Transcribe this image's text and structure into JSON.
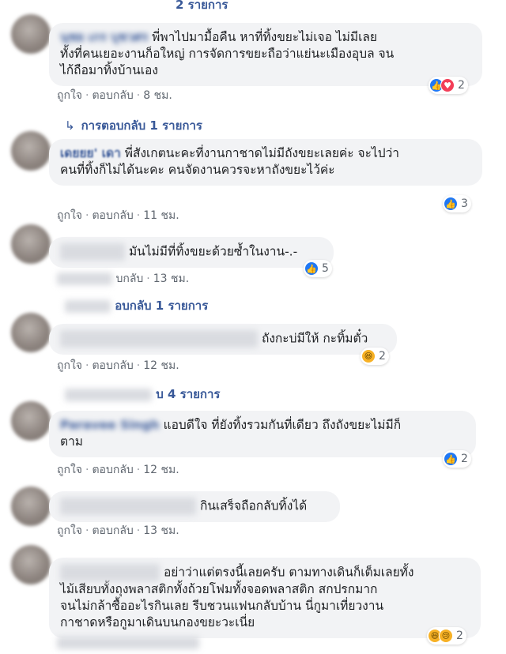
{
  "top_partial": {
    "text": "2 รายการ"
  },
  "comments": [
    {
      "author": "นุชย เกร บุชวศร",
      "text_lines": [
        "พี่พาไปมามื้อคืน หาที่ทิ้งขยะไม่เจอ ไม่มีเลย",
        "ทั้งที่คนเยอะงานก็อใหญ่ การจัดการขยะถือว่าแย่นะเมืองอุบล จน",
        "ไก้ถือมาทิ้งบ้านเอง"
      ],
      "like": "ถูกใจ",
      "reply": "ตอบกลับ",
      "time": "8 ชม.",
      "reactions": [
        "like-icon",
        "love-icon"
      ],
      "reaction_count": "2"
    },
    {
      "author": "เดยยย' เดา",
      "text_lines": [
        "พี่สังเกตนะคะที่งานกาชาดไม่มีถังขยะเลยค่ะ จะไปว่า",
        "คนที่ทิ้งก็ไม่ได้นะคะ คนจัดงานควรจะหาถังขยะไว้ค่ะ"
      ],
      "like": "ถูกใจ",
      "reply": "ตอบกลับ",
      "time": "11 ชม.",
      "reactions": [
        "like-icon"
      ],
      "reaction_count": "3"
    },
    {
      "author": "",
      "text_lines": [
        "มันไม่มีที่ทิ้งขยะด้วยซ้ำในงาน-.-"
      ],
      "like": "",
      "reply": "บกลับ",
      "time": "13 ชม.",
      "reactions": [
        "like-icon"
      ],
      "reaction_count": "5"
    },
    {
      "author": "",
      "text_lines": [
        "ถังกะบ่มีให้ กะทิ้มตั๋ว"
      ],
      "like": "ถูกใจ",
      "reply": "ตอบกลับ",
      "time": "12 ชม.",
      "reactions": [
        "haha-icon"
      ],
      "reaction_count": "2"
    },
    {
      "author": "Paravee Singh",
      "text_lines": [
        "แอบดีใจ ที่ยังทิ้งรวมกันที่เดียว ถึงถังขยะไม่มีก็",
        "ตาม"
      ],
      "like": "ถูกใจ",
      "reply": "ตอบกลับ",
      "time": "12 ชม.",
      "reactions": [
        "like-icon"
      ],
      "reaction_count": "2"
    },
    {
      "author": "",
      "text_lines": [
        "กินเสร็จถือกลับทิ้งได้"
      ],
      "like": "ถูกใจ",
      "reply": "ตอบกลับ",
      "time": "13 ชม.",
      "reactions": [],
      "reaction_count": ""
    },
    {
      "author": "",
      "text_lines": [
        "อย่าว่าแต่ตรงนี้เลยครับ ตามทางเดินก็เต็มเลยทั้ง",
        "ไม้เสียบทั้งถุงพลาสติกทั้งถ้วยโฟมทั้งจอดพลาสติก สกปรกมาก",
        "จนไม่กล้าซื้ออะไรกินเลย รีบชวนแฟนกลับบ้าน นี่กูมาเที่ยวงาน",
        "กาชาดหรือกูมาเดินบนกองขยะวะเนี่ย"
      ],
      "like": "",
      "reply": "",
      "time": "",
      "reactions": [
        "haha-icon",
        "sad-icon"
      ],
      "reaction_count": "2"
    }
  ],
  "reply_links": [
    {
      "text": "การตอบกลับ 1 รายการ"
    },
    {
      "text": "อบกลับ 1 รายการ"
    },
    {
      "text": "บ 4 รายการ"
    }
  ]
}
